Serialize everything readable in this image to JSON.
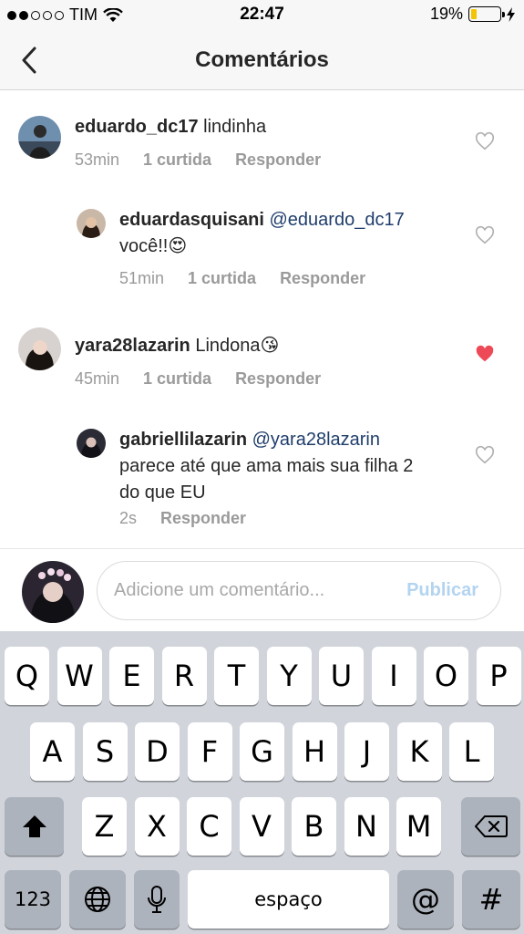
{
  "status_bar": {
    "carrier": "TIM",
    "time": "22:47",
    "battery_percent": "19%",
    "battery_level": 0.19
  },
  "nav": {
    "title": "Comentários"
  },
  "comments": [
    {
      "username": "eduardo_dc17",
      "text": " lindinha",
      "time": "53min",
      "likes": "1 curtida",
      "reply": "Responder",
      "liked": false
    },
    {
      "username": "eduardasquisani",
      "mention": "@eduardo_dc17",
      "text_line2": "você!!😍",
      "time": "51min",
      "likes": "1 curtida",
      "reply": "Responder",
      "liked": false
    },
    {
      "username": "yara28lazarin",
      "text": " Lindona😘",
      "time": "45min",
      "likes": "1 curtida",
      "reply": "Responder",
      "liked": true
    },
    {
      "username": "gabriellilazarin",
      "mention": "@yara28lazarin",
      "text_line2": "parece até que ama mais sua filha 2",
      "text_line3": "do que EU",
      "time": "2s",
      "reply": "Responder",
      "liked": false
    }
  ],
  "composer": {
    "placeholder": "Adicione um comentário...",
    "publish_label": "Publicar"
  },
  "keyboard": {
    "row1": [
      "Q",
      "W",
      "E",
      "R",
      "T",
      "Y",
      "U",
      "I",
      "O",
      "P"
    ],
    "row2": [
      "A",
      "S",
      "D",
      "F",
      "G",
      "H",
      "J",
      "K",
      "L"
    ],
    "row3": [
      "Z",
      "X",
      "C",
      "V",
      "B",
      "N",
      "M"
    ],
    "numbers_label": "123",
    "space_label": "espaço",
    "at_label": "@",
    "hash_label": "#"
  },
  "colors": {
    "heart_liked": "#ed4956",
    "heart_empty": "#b0b0b0",
    "publish_disabled": "#b3d4f0"
  }
}
